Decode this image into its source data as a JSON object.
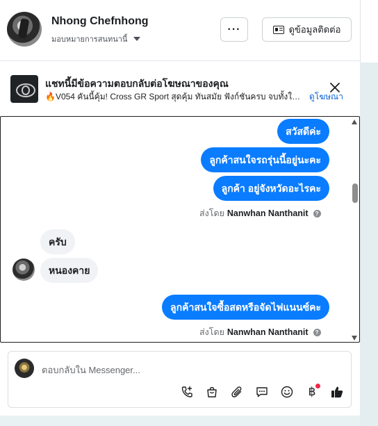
{
  "header": {
    "name": "Nhong Chefnhong",
    "subtitle": "มอบหมายการสนทนานี้",
    "more_label": "···",
    "contact_label": "ดูข้อมูลติดต่อ"
  },
  "ad_banner": {
    "title": "แชทนี้มีข้อความตอบกลับต่อโฆษณาของคุณ",
    "description": "🔥V054 คันนี้คุ้ม! Cross GR Sport สุดคุ้ม ทันสมัย ฟังก์ชันครบ จบทั้งใช้…",
    "link_label": "ดูโฆษณา"
  },
  "messages": [
    {
      "direction": "out",
      "text": "สวัสดีค่ะ"
    },
    {
      "direction": "out",
      "text": "ลูกค้าสนใจรถรุ่นนี้อยู่นะคะ"
    },
    {
      "direction": "out",
      "text": "ลูกค้า   อยู่จังหวัดอะไรคะ"
    },
    {
      "direction": "in",
      "text": "ครับ"
    },
    {
      "direction": "in",
      "text": "หนองคาย"
    },
    {
      "direction": "out",
      "text": "ลูกค้าสนใจซื้อสดหรือจัดไฟแนนซ์คะ"
    }
  ],
  "sent_by": {
    "prefix": "ส่งโดย",
    "agent": "Nanwhan Nanthanit"
  },
  "composer": {
    "placeholder": "ตอบกลับใน Messenger...",
    "tools": [
      "phone-add-icon",
      "shopping-bag-icon",
      "paperclip-icon",
      "chat-bubble-icon",
      "emoji-icon",
      "baht-icon",
      "thumbs-up-icon"
    ],
    "baht_symbol": "฿"
  },
  "colors": {
    "outgoing_bubble": "#0a7cff",
    "incoming_bubble": "#f0f2f5",
    "link": "#0a63d6",
    "notification_dot": "#f02849"
  }
}
